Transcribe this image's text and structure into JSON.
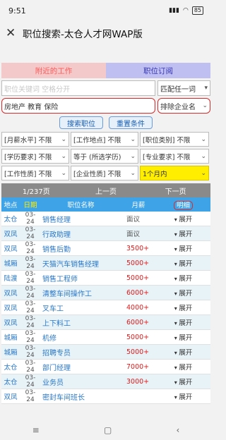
{
  "status_bar": {
    "time": "9:51",
    "signal": "▮▮▮",
    "battery": "85"
  },
  "app_bar": {
    "title": "职位搜索-太仓人才网WAP版"
  },
  "tabs": [
    {
      "label": "附近的工作"
    },
    {
      "label": "职位订阅"
    }
  ],
  "search": {
    "keyword_placeholder": "职位关键词 空格分开",
    "match_mode": "匹配任一词",
    "include_text": "房地产 教育 保险",
    "exclude_placeholder": "排除企业名"
  },
  "buttons": {
    "search": "搜索职位",
    "reset": "重置条件"
  },
  "filters": [
    "[月薪水平] 不限",
    "[工作地点] 不限",
    "[职位类别] 不限",
    "[学历要求] 不限",
    "等于 (所选学历)",
    "[专业要求] 不限",
    "[工作性质] 不限",
    "[企业性质] 不限",
    "1个月内"
  ],
  "pager": {
    "page": "1/237页",
    "prev": "上一页",
    "next": "下一页"
  },
  "table": {
    "headers": {
      "loc": "地点",
      "date": "日期",
      "title": "职位名称",
      "salary": "月薪",
      "detail": "明细"
    },
    "expand_label": "展开",
    "rows": [
      {
        "loc": "太仓",
        "date": "03-24",
        "title": "销售经理",
        "salary": "面议",
        "salary_red": false
      },
      {
        "loc": "双凤",
        "date": "03-24",
        "title": "行政助理",
        "salary": "面议",
        "salary_red": false
      },
      {
        "loc": "双凤",
        "date": "03-24",
        "title": "销售后勤",
        "salary": "3500+",
        "salary_red": true
      },
      {
        "loc": "城厢",
        "date": "03-24",
        "title": "天猫汽车销售经理",
        "salary": "5000+",
        "salary_red": true
      },
      {
        "loc": "陆渡",
        "date": "03-24",
        "title": "销售工程师",
        "salary": "5000+",
        "salary_red": true
      },
      {
        "loc": "双凤",
        "date": "03-24",
        "title": "清整车间操作工",
        "salary": "6000+",
        "salary_red": true
      },
      {
        "loc": "双凤",
        "date": "03-24",
        "title": "叉车工",
        "salary": "4000+",
        "salary_red": true
      },
      {
        "loc": "双凤",
        "date": "03-24",
        "title": "上下料工",
        "salary": "6000+",
        "salary_red": true
      },
      {
        "loc": "城厢",
        "date": "03-24",
        "title": "机修",
        "salary": "5000+",
        "salary_red": true
      },
      {
        "loc": "城厢",
        "date": "03-24",
        "title": "招聘专员",
        "salary": "5000+",
        "salary_red": true
      },
      {
        "loc": "太仓",
        "date": "03-24",
        "title": "部门经理",
        "salary": "7000+",
        "salary_red": true
      },
      {
        "loc": "太仓",
        "date": "03-24",
        "title": "业务员",
        "salary": "3000+",
        "salary_red": true
      },
      {
        "loc": "双凤",
        "date": "03-24",
        "title": "密封车间班长",
        "salary": "",
        "salary_red": true
      }
    ]
  },
  "nav": {
    "menu": "≡",
    "home": "▢",
    "back": "‹"
  }
}
